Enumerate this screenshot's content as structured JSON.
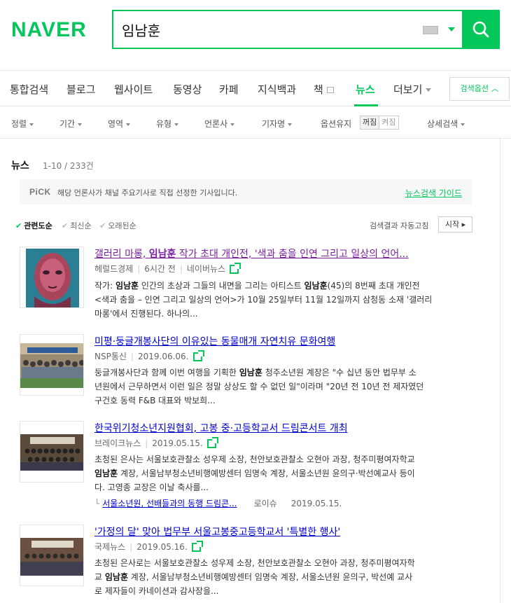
{
  "logo": "NAVER",
  "search": {
    "query": "임남훈"
  },
  "tabs": [
    {
      "label": "통합검색"
    },
    {
      "label": "블로그"
    },
    {
      "label": "웹사이트"
    },
    {
      "label": "동영상"
    },
    {
      "label": "카페"
    },
    {
      "label": "지식백과"
    },
    {
      "label": "책"
    },
    {
      "label": "뉴스"
    },
    {
      "label": "더보기"
    }
  ],
  "search_options_label": "검색옵션",
  "filters": [
    "정렬",
    "기간",
    "영역",
    "유형",
    "언론사",
    "기자명",
    "옵션유지",
    "상세검색"
  ],
  "option_toggle": {
    "off": "꺼짐",
    "on": "켜짐"
  },
  "section": {
    "title": "뉴스",
    "count": "1-10 / 233건"
  },
  "pick": {
    "logo": "PiCK",
    "text": "해당 언론사가 채널 주요기사로 직접 선정한 기사입니다.",
    "link": "뉴스검색 가이드"
  },
  "sort_options": [
    "관련도순",
    "최신순",
    "오래된순"
  ],
  "auto_refresh": {
    "label": "검색결과 자동고침",
    "button": "시작"
  },
  "news": [
    {
      "title_pre": "갤러리 마롱, ",
      "title_hl": "임남훈",
      "title_post": " 작가 초대 개인전, '색과 춤을 인연 그리고 일상의 언어...",
      "press": "헤럴드경제",
      "time": "6시간 전",
      "source": "네이버뉴스",
      "line1_pre": "작가: ",
      "line1_hl": "임남훈",
      "line1_mid": " 인간의 초상과 그들의 내면을 그리는 아티스트 ",
      "line1_hl2": "임남훈",
      "line1_post": "(45)의 8번째 초대 개인전",
      "line2": "<색과 춤을 – 인연 그리고 일상의 언어>가 10월 25일부터 11월 12일까지 삼청동 소재 '갤러리",
      "line3": "마롱'에서 진행된다. 하나의..."
    },
    {
      "title": "미평·둥글개봉사단의 이유있는 동물매개 자연치유 문화여행",
      "press": "NSP통신",
      "date": "2019.06.06.",
      "line1_pre": "둥글개봉사단과 함께 이번 여행을 기획한 ",
      "line1_hl": "임남훈",
      "line1_post": " 청주소년원 계장은 \"수 십년 동안 법무부 소",
      "line2": "년원에서 근무하면서 이런 일은 정말 상상도 할 수 없던 일\"이라며 \"20년 전 10년 전 제자였던",
      "line3": "구건호 동력 F&B 대표와 박보희..."
    },
    {
      "title": "한국위기청소년지원협회, 고봉 중·고등학교서 드림콘서트 개최",
      "press": "브레이크뉴스",
      "date": "2019.05.15.",
      "line1": "초청된 은사는 서울보호관찰소 성우제 소장, 천안보호관찰소 오현아 과장, 청주미평여자학교",
      "line2_hl": "임남훈",
      "line2_post": " 계장, 서울남부청소년비행예방센터 임명숙 계장, 서울소년원 윤의구·박선예교사 등이",
      "line3": "다. 고영종 교장은 이날 축사를...",
      "related": {
        "title": "서울소년원, 선배들과의 동행 드림콘...",
        "press": "로이슈",
        "date": "2019.05.15."
      }
    },
    {
      "title": "'가정의 달' 맞아 법무부 서울고봉중고등학교서 '특별한 행사'",
      "press": "국제뉴스",
      "date": "2019.05.16.",
      "line1": "초청된 은사로는 서울보호관찰소 성우제 소장, 천안보호관찰소 오현아 과장, 청주미평여자학",
      "line2_pre": "교 ",
      "line2_hl": "임남훈",
      "line2_post": " 계장, 서울남부청소년비행예방센터 임명숙 계장, 서울소년원 윤의구, 박선예 교사",
      "line3": "로 제자들이 카네이션과 감사장을..."
    }
  ],
  "colors": {
    "brand": "#03c75a",
    "link": "#0000cc",
    "visited": "#7b1fa2"
  }
}
